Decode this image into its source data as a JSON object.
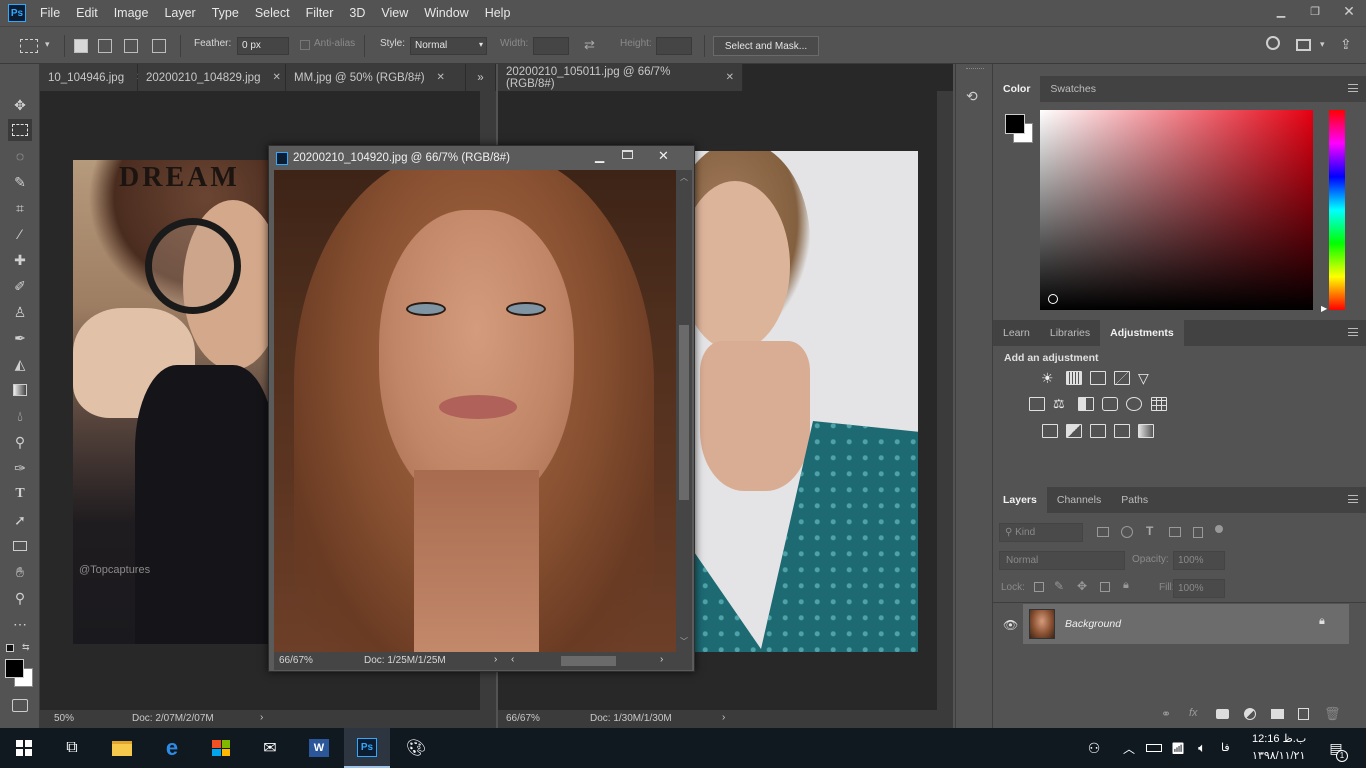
{
  "menu": [
    "File",
    "Edit",
    "Image",
    "Layer",
    "Type",
    "Select",
    "Filter",
    "3D",
    "View",
    "Window",
    "Help"
  ],
  "app_icon": "Ps",
  "options": {
    "feather_label": "Feather:",
    "feather_value": "0 px",
    "antialias_label": "Anti-alias",
    "style_label": "Style:",
    "style_value": "Normal",
    "width_label": "Width:",
    "height_label": "Height:",
    "select_mask_label": "Select and Mask..."
  },
  "tabs_left": [
    {
      "label": "10_104946.jpg"
    },
    {
      "label": "20200210_104829.jpg"
    },
    {
      "label": "MM.jpg @ 50% (RGB/8#)"
    }
  ],
  "overflow_label": "»",
  "tabs_right": [
    {
      "label": "20200210_105011.jpg @ 66/7% (RGB/8#)"
    }
  ],
  "left_doc": {
    "zoom": "50%",
    "doc_info": "Doc: 2/07M/2/07M",
    "overlay_title": "DREAM",
    "watermark": "@Topcaptures"
  },
  "right_doc": {
    "zoom": "66/67%",
    "doc_info": "Doc: 1/30M/1/30M"
  },
  "float_window": {
    "title": "20200210_104920.jpg @ 66/7% (RGB/8#)",
    "zoom": "66/67%",
    "doc_info": "Doc: 1/25M/1/25M"
  },
  "color_panel": {
    "tabs": [
      "Color",
      "Swatches"
    ],
    "active": "Color"
  },
  "adjust_panel": {
    "tabs": [
      "Learn",
      "Libraries",
      "Adjustments"
    ],
    "active": "Adjustments",
    "heading": "Add an adjustment"
  },
  "layers_panel": {
    "tabs": [
      "Layers",
      "Channels",
      "Paths"
    ],
    "active": "Layers",
    "kind_placeholder": "Kind",
    "blend_mode": "Normal",
    "opacity_label": "Opacity:",
    "opacity_value": "100%",
    "lock_label": "Lock:",
    "fill_label": "Fill:",
    "fill_value": "100%",
    "layer_name": "Background"
  },
  "taskbar": {
    "time": "12:16 ب.ظ",
    "date": "۱۳۹۸/۱۱/۲۱",
    "lang": "فا",
    "notif_count": "1"
  },
  "colors": {
    "ui_bg": "#535353",
    "canvas_bg": "#282828",
    "accent": "#31a8ff",
    "taskbar": "#101820"
  }
}
